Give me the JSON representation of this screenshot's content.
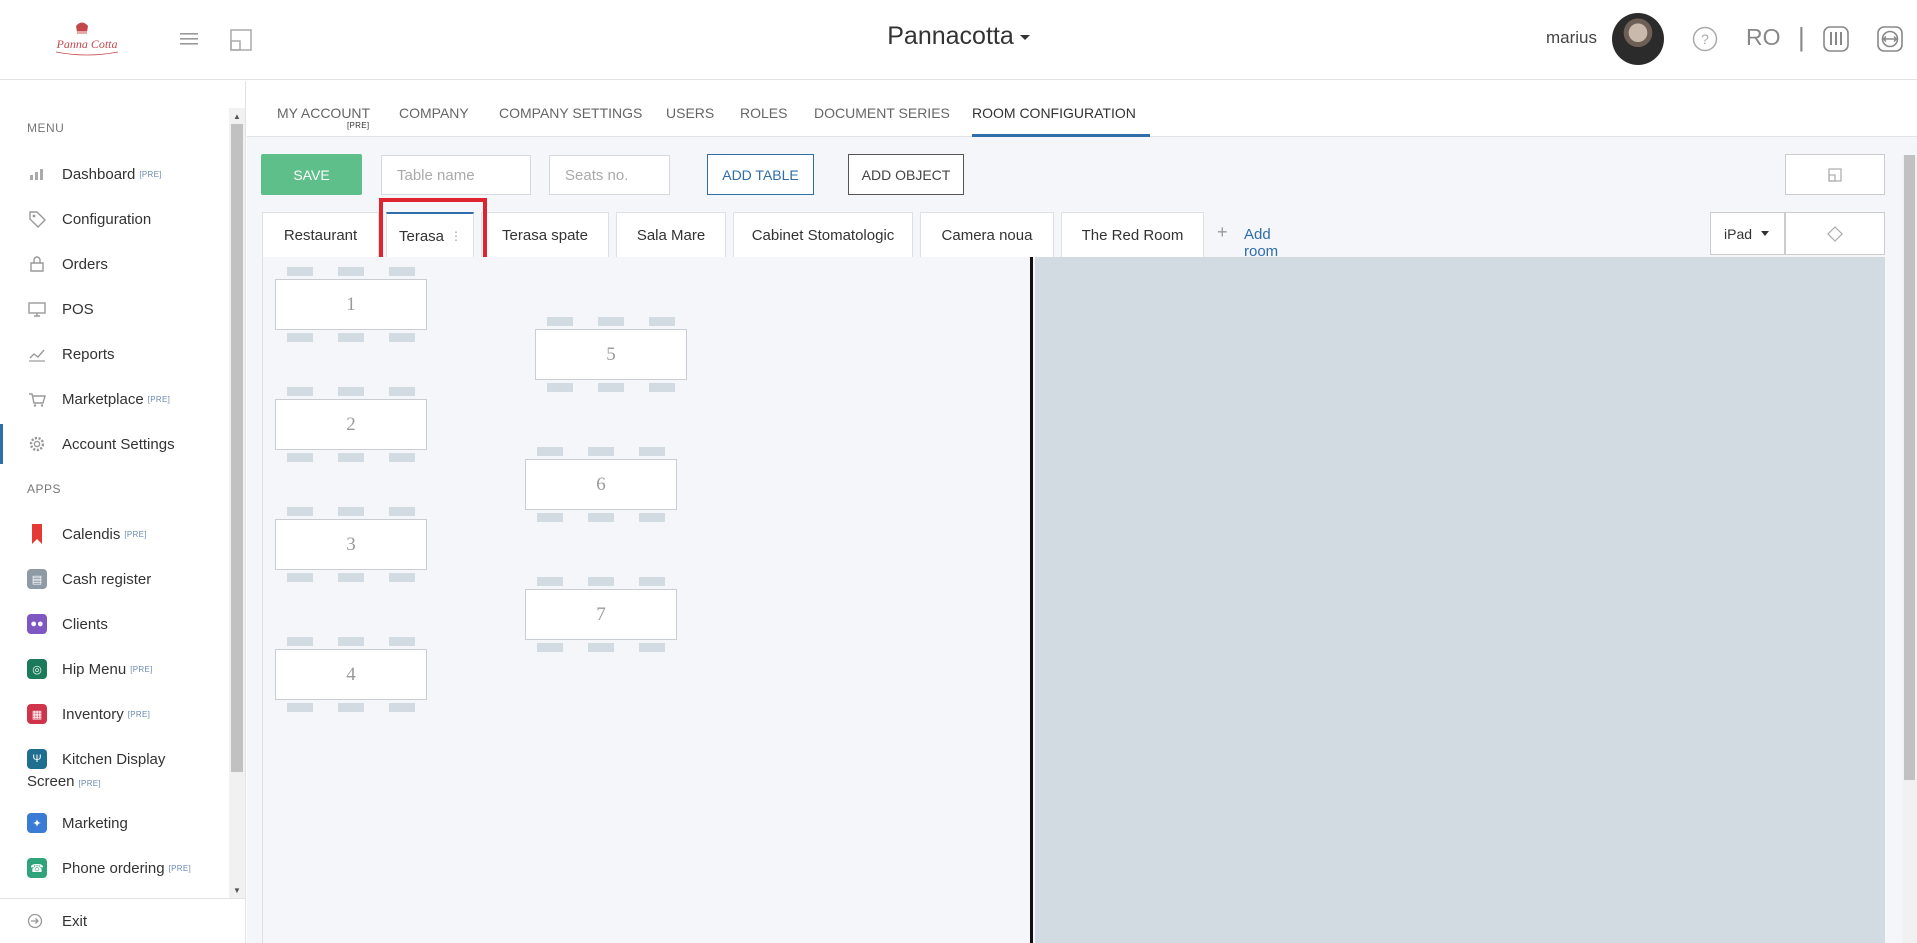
{
  "header": {
    "logo_text": "Panna Cotta",
    "brand": "Pannacotta",
    "username": "marius",
    "language": "RO",
    "separator": "|"
  },
  "sidebar": {
    "menu_heading": "MENU",
    "apps_heading": "APPS",
    "pre_tag": "[PRE]",
    "menu_items": [
      {
        "label": "Dashboard",
        "pre": true,
        "icon": "bar-chart-icon"
      },
      {
        "label": "Configuration",
        "pre": false,
        "icon": "tag-icon"
      },
      {
        "label": "Orders",
        "pre": false,
        "icon": "cart-lock-icon"
      },
      {
        "label": "POS",
        "pre": false,
        "icon": "monitor-icon"
      },
      {
        "label": "Reports",
        "pre": false,
        "icon": "line-chart-icon"
      },
      {
        "label": "Marketplace",
        "pre": true,
        "icon": "basket-icon"
      },
      {
        "label": "Account Settings",
        "pre": false,
        "icon": "gear-icon",
        "active": true
      }
    ],
    "app_items": [
      {
        "label": "Calendis",
        "pre": true,
        "icon": "bookmark-icon",
        "color": "#e53935"
      },
      {
        "label": "Cash register",
        "pre": false,
        "icon": "cash-register-icon",
        "color": "#8e9aa6"
      },
      {
        "label": "Clients",
        "pre": false,
        "icon": "users-icon",
        "color": "#7e57c2"
      },
      {
        "label": "Hip Menu",
        "pre": true,
        "icon": "compass-icon",
        "color": "#1b7a5a"
      },
      {
        "label": "Inventory",
        "pre": true,
        "icon": "inventory-icon",
        "color": "#d0344a"
      },
      {
        "label": "Kitchen Display",
        "label2": "Screen",
        "pre": true,
        "icon": "utensils-icon",
        "color": "#1e6f8f"
      },
      {
        "label": "Marketing",
        "pre": false,
        "icon": "marketing-icon",
        "color": "#3a7bd5"
      },
      {
        "label": "Phone ordering",
        "pre": true,
        "icon": "phone-icon",
        "color": "#2fa37a"
      }
    ],
    "exit_label": "Exit"
  },
  "tabs": [
    {
      "label": "MY ACCOUNT",
      "pre": "[PRE]"
    },
    {
      "label": "COMPANY"
    },
    {
      "label": "COMPANY SETTINGS"
    },
    {
      "label": "USERS"
    },
    {
      "label": "ROLES"
    },
    {
      "label": "DOCUMENT SERIES"
    },
    {
      "label": "ROOM CONFIGURATION",
      "active": true
    }
  ],
  "toolbar": {
    "save_label": "SAVE",
    "table_name_placeholder": "Table name",
    "seats_placeholder": "Seats no.",
    "add_table_label": "ADD TABLE",
    "add_object_label": "ADD OBJECT"
  },
  "rooms": {
    "items": [
      "Restaurant",
      "Terasa",
      "Terasa spate",
      "Sala Mare",
      "Cabinet Stomatologic",
      "Camera noua",
      "The Red Room"
    ],
    "active": "Terasa",
    "add_label": "Add room",
    "device": "iPad"
  },
  "tables": [
    "1",
    "2",
    "3",
    "4",
    "5",
    "6",
    "7"
  ],
  "colors": {
    "accent": "#2f6ea8",
    "save": "#5fbf8b",
    "highlight": "#e0242f"
  }
}
